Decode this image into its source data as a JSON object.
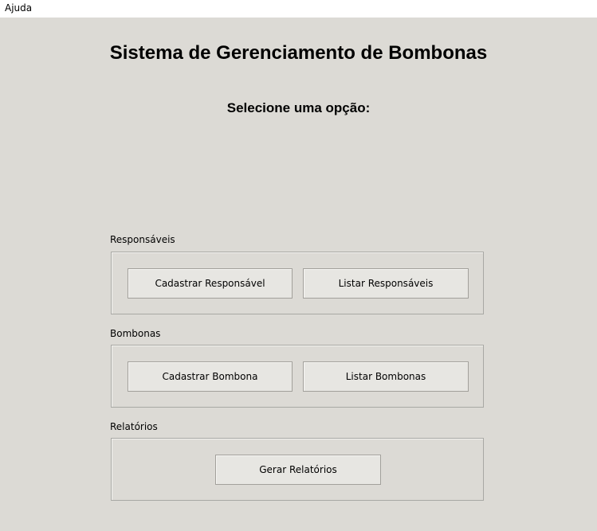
{
  "menubar": {
    "items": [
      "Ajuda"
    ]
  },
  "header": {
    "title": "Sistema de Gerenciamento de Bombonas",
    "subtitle": "Selecione uma opção:"
  },
  "groups": {
    "responsaveis": {
      "label": "Responsáveis",
      "buttons": [
        "Cadastrar Responsável",
        "Listar Responsáveis"
      ]
    },
    "bombonas": {
      "label": "Bombonas",
      "buttons": [
        "Cadastrar Bombona",
        "Listar Bombonas"
      ]
    },
    "relatorios": {
      "label": "Relatórios",
      "buttons": [
        "Gerar Relatórios"
      ]
    }
  },
  "colors": {
    "window_background": "#dcdad5",
    "menubar_background": "#ffffff",
    "button_background": "#e7e6e2",
    "border": "#a8a8a4"
  }
}
